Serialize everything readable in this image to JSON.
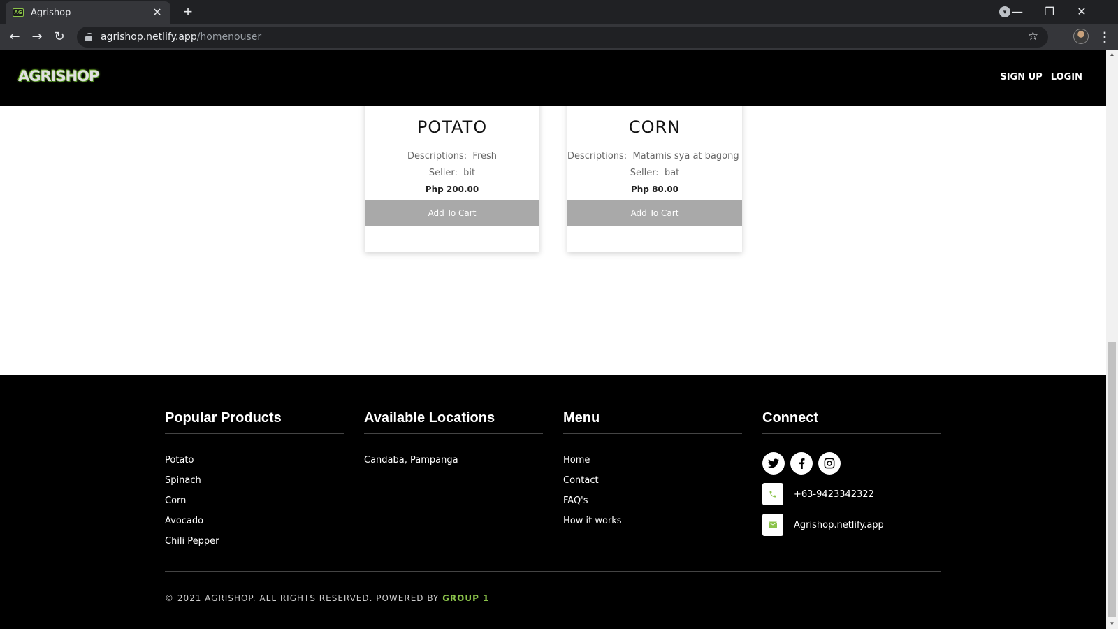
{
  "browser": {
    "tab_title": "Agrishop",
    "tab_favicon_text": "AG",
    "tab_close": "✕",
    "new_tab": "+",
    "url_host": "agrishop.netlify.app",
    "url_path": "/homenouser",
    "window_controls": {
      "minimize": "—",
      "restore": "❐",
      "close": "✕"
    }
  },
  "header": {
    "logo": "AGRISHOP",
    "nav": [
      "SIGN UP",
      "LOGIN"
    ]
  },
  "products": [
    {
      "name": "POTATO",
      "description_label": "Descriptions:",
      "description": "Fresh",
      "seller_label": "Seller:",
      "seller": "bit",
      "price": "Php 200.00",
      "button": "Add To Cart"
    },
    {
      "name": "CORN",
      "description_label": "Descriptions:",
      "description": "Matamis sya at bagong ani",
      "seller_label": "Seller:",
      "seller": "bat",
      "price": "Php 80.00",
      "button": "Add To Cart"
    }
  ],
  "footer": {
    "popular_products": {
      "heading": "Popular Products",
      "items": [
        "Potato",
        "Spinach",
        "Corn",
        "Avocado",
        "Chili Pepper"
      ]
    },
    "locations": {
      "heading": "Available Locations",
      "items": [
        "Candaba, Pampanga"
      ]
    },
    "menu": {
      "heading": "Menu",
      "items": [
        "Home",
        "Contact",
        "FAQ's",
        "How it works"
      ]
    },
    "connect": {
      "heading": "Connect",
      "social": [
        "twitter-icon",
        "facebook-icon",
        "instagram-icon"
      ],
      "phone": "+63-9423342322",
      "email": "Agrishop.netlify.app"
    },
    "copyright_prefix": "© 2021 AGRISHOP. ALL RIGHTS RESERVED. POWERED BY",
    "copyright_accent": "GROUP 1"
  },
  "colors": {
    "accent_green": "#8bc34a",
    "button_gray": "#a9a9a9",
    "footer_bg": "#000000"
  }
}
